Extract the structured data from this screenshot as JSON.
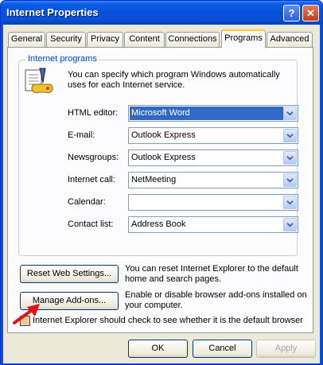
{
  "window": {
    "title": "Internet Properties",
    "help_glyph": "?",
    "close_glyph": "✕"
  },
  "tabs": [
    {
      "label": "General"
    },
    {
      "label": "Security"
    },
    {
      "label": "Privacy"
    },
    {
      "label": "Content"
    },
    {
      "label": "Connections"
    },
    {
      "label": "Programs",
      "active": true
    },
    {
      "label": "Advanced"
    }
  ],
  "programs": {
    "group_title": "Internet programs",
    "description": "You can specify which program Windows automatically uses for each Internet service.",
    "fields": [
      {
        "label": "HTML editor:",
        "value": "Microsoft Word",
        "selected": true
      },
      {
        "label": "E-mail:",
        "value": "Outlook Express"
      },
      {
        "label": "Newsgroups:",
        "value": "Outlook Express"
      },
      {
        "label": "Internet call:",
        "value": "NetMeeting"
      },
      {
        "label": "Calendar:",
        "value": ""
      },
      {
        "label": "Contact list:",
        "value": "Address Book"
      }
    ]
  },
  "reset": {
    "button": "Reset Web Settings...",
    "text": "You can reset Internet Explorer to the default home and search pages."
  },
  "addons": {
    "button": "Manage Add-ons...",
    "text": "Enable or disable browser add-ons installed on your computer."
  },
  "default_check": {
    "label": "Internet Explorer should check to see whether it is the default browser",
    "checked": false
  },
  "footer": {
    "ok": "OK",
    "cancel": "Cancel",
    "apply": "Apply"
  },
  "colors": {
    "title_bar": "#0650d8",
    "annotation_arrow": "#e81010"
  }
}
